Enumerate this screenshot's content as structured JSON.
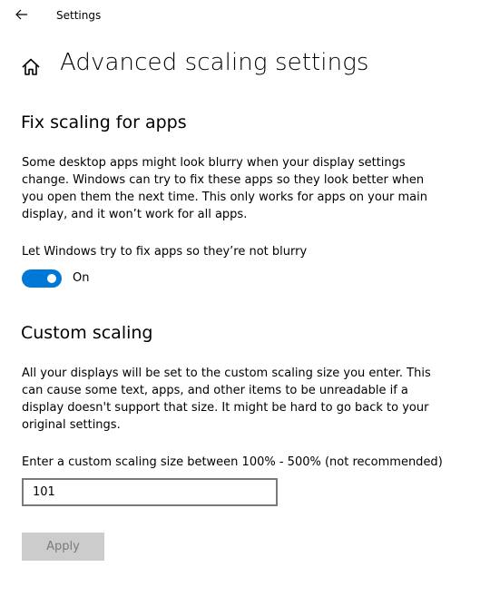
{
  "window": {
    "app_title": "Settings"
  },
  "page": {
    "title": "Advanced scaling settings"
  },
  "fix_scaling": {
    "heading": "Fix scaling for apps",
    "description": "Some desktop apps might look blurry when your display settings change. Windows can try to fix these apps so they look better when you open them the next time. This only works for apps on your main display, and it won’t work for all apps.",
    "toggle_label": "Let Windows try to fix apps so they’re not blurry",
    "toggle_on": true,
    "toggle_state_text": "On"
  },
  "custom_scaling": {
    "heading": "Custom scaling",
    "description": "All your displays will be set to the custom scaling size you enter. This can cause some text, apps, and other items to be unreadable if a display doesn't support that size. It might be hard to go back to your original settings.",
    "input_label": "Enter a custom scaling size between 100% - 500% (not recommended)",
    "input_value": "101",
    "apply_label": "Apply"
  },
  "colors": {
    "accent": "#0078d7",
    "disabled_button_bg": "#cccccc",
    "disabled_button_text": "#7a7a7a"
  },
  "icons": {
    "back": "back-arrow-icon",
    "home": "home-icon"
  }
}
